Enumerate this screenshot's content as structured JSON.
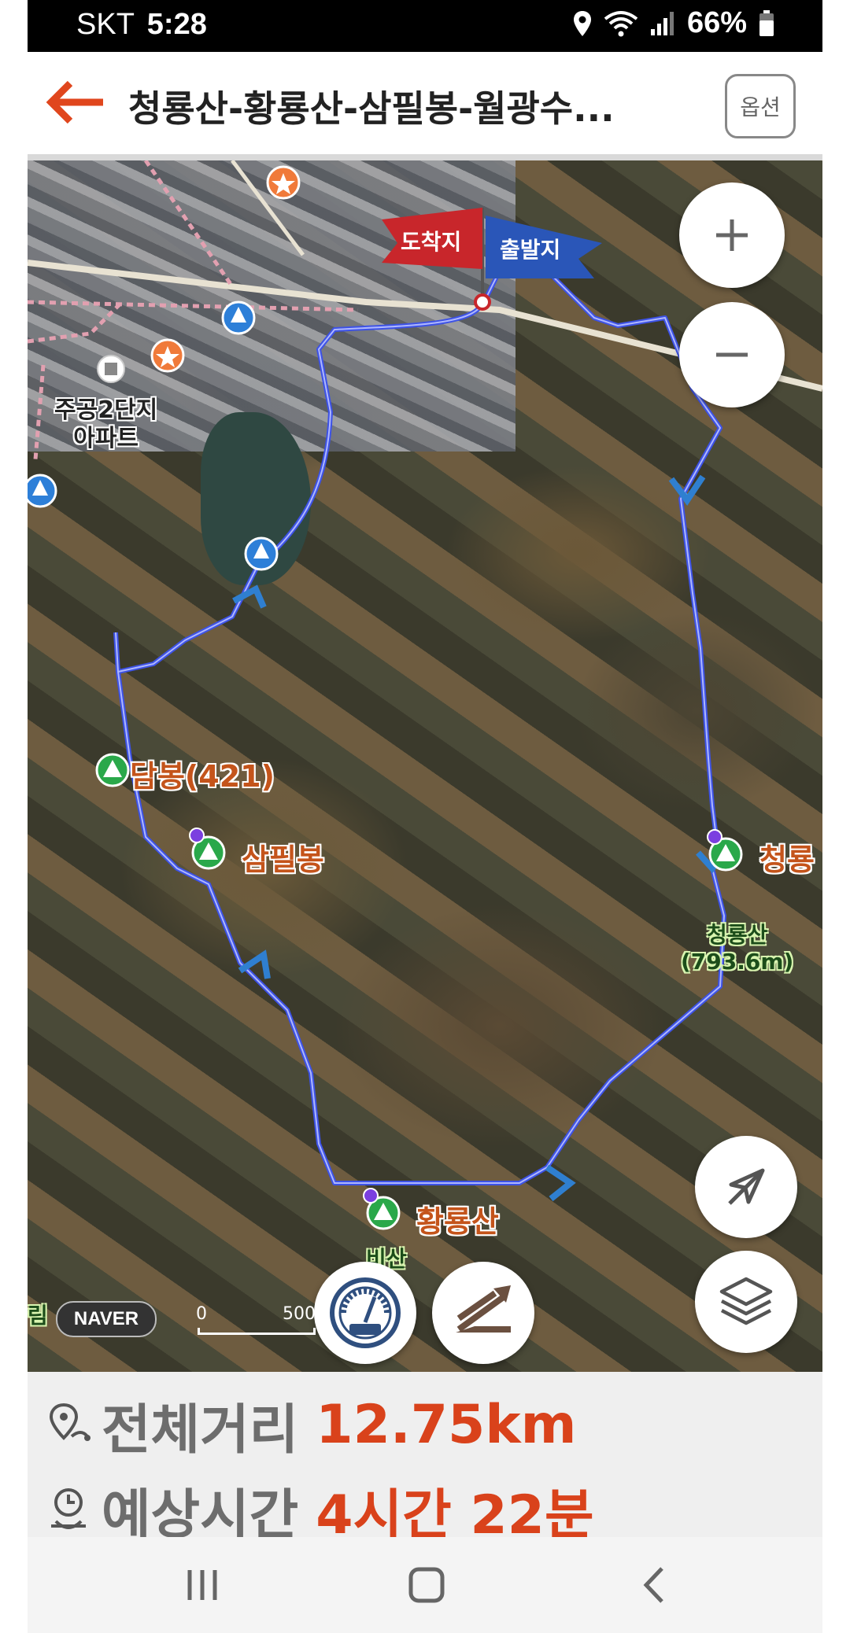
{
  "status_bar": {
    "carrier": "SKT",
    "time": "5:28",
    "battery": "66%",
    "icons": [
      "location-icon",
      "wifi-icon",
      "signal-icon",
      "battery-icon"
    ]
  },
  "header": {
    "title": "청룡산-황룡산-삼필봉-월광수...",
    "option_button": "옵션"
  },
  "map": {
    "flags": {
      "arrival": "도착지",
      "departure": "출발지"
    },
    "labels": {
      "apartment_line1": "주공2단지",
      "apartment_line2": "아파트",
      "dambong": "담봉(421)",
      "sampilbong": "삼필봉",
      "hwangryongsan": "황룡산",
      "cheongryong_right": "청룡",
      "cheongryongsan_line1": "청룡산",
      "cheongryongsan_line2": "(793.6m)",
      "bisan": "비산",
      "left_edge": "림"
    },
    "naver_logo": "NAVER",
    "scale": {
      "start": "0",
      "end": "500"
    },
    "route_color": "#3d52e6",
    "flag_colors": {
      "arrival": "#c8262b",
      "departure": "#2a56b8"
    }
  },
  "summary": {
    "distance_label": "전체거리",
    "distance_value": "12.75km",
    "time_label": "예상시간",
    "time_value": "4시간 22분"
  },
  "nav": {
    "icons": [
      "recent-apps-icon",
      "home-icon",
      "back-icon"
    ]
  }
}
